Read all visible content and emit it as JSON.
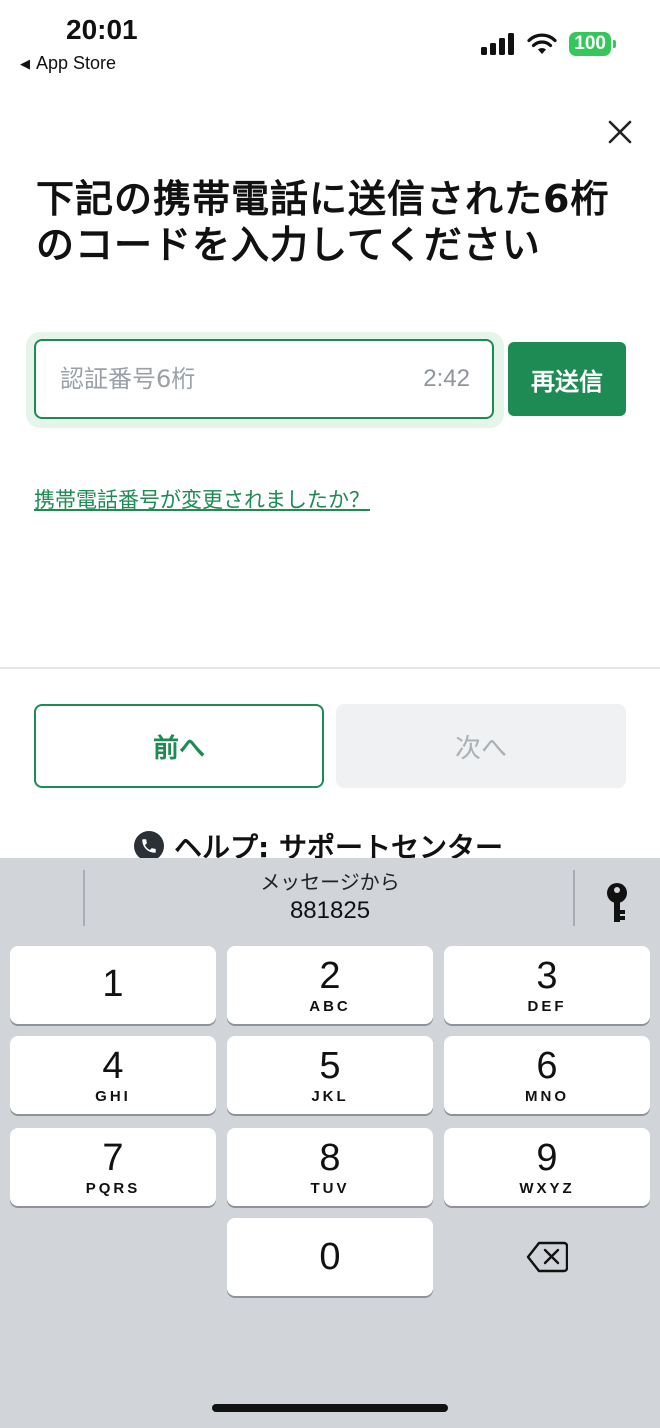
{
  "status_bar": {
    "time": "20:01",
    "back_app": "App Store",
    "battery": "100"
  },
  "header": {
    "title": "下記の携帯電話に送信された6桁のコードを入力してください"
  },
  "code_entry": {
    "placeholder": "認証番号6桁",
    "timer": "2:42",
    "resend_label": "再送信"
  },
  "change_phone_link": "携帯電話番号が変更されましたか？",
  "nav": {
    "prev_label": "前へ",
    "next_label": "次へ"
  },
  "help": {
    "prefix": "ヘルプ",
    "colon": ":",
    "label": "サポートセンター"
  },
  "keyboard": {
    "suggestion_source": "メッセージから",
    "suggestion_code": "881825",
    "keys": [
      {
        "num": "1",
        "letters": ""
      },
      {
        "num": "2",
        "letters": "ABC"
      },
      {
        "num": "3",
        "letters": "DEF"
      },
      {
        "num": "4",
        "letters": "GHI"
      },
      {
        "num": "5",
        "letters": "JKL"
      },
      {
        "num": "6",
        "letters": "MNO"
      },
      {
        "num": "7",
        "letters": "PQRS"
      },
      {
        "num": "8",
        "letters": "TUV"
      },
      {
        "num": "9",
        "letters": "WXYZ"
      },
      {
        "num": "0",
        "letters": ""
      }
    ]
  },
  "colors": {
    "accent": "#1e8a54",
    "keyboard_bg": "#d1d4d9",
    "disabled_bg": "#eff1f3"
  },
  "icons": [
    "back-triangle-icon",
    "signal-icon",
    "wifi-icon",
    "battery-icon",
    "close-icon",
    "phone-icon",
    "key-icon",
    "delete-icon"
  ]
}
